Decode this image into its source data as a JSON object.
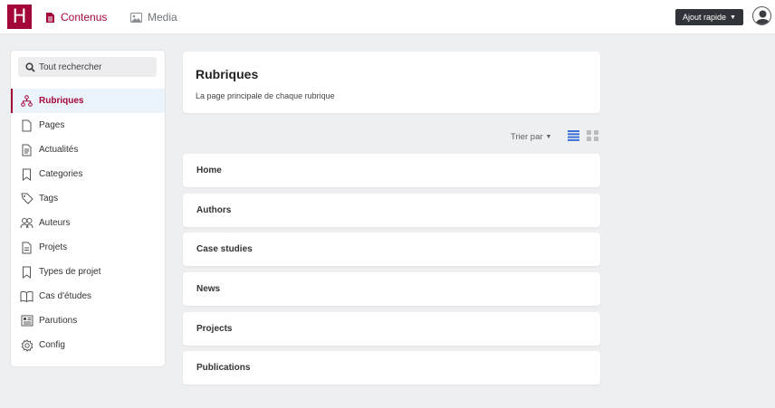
{
  "topbar": {
    "logo": "H",
    "nav": [
      {
        "label": "Contenus",
        "icon": "document-icon"
      },
      {
        "label": "Media",
        "icon": "image-icon"
      }
    ],
    "quick_add": "Ajout rapide"
  },
  "sidebar": {
    "search_placeholder": "Tout rechercher",
    "active_index": 0,
    "items": [
      {
        "label": "Rubriques",
        "icon": "sitemap-icon"
      },
      {
        "label": "Pages",
        "icon": "page-icon"
      },
      {
        "label": "Actualités",
        "icon": "news-icon"
      },
      {
        "label": "Categories",
        "icon": "bookmark-icon"
      },
      {
        "label": "Tags",
        "icon": "tag-icon"
      },
      {
        "label": "Auteurs",
        "icon": "users-icon"
      },
      {
        "label": "Projets",
        "icon": "project-icon"
      },
      {
        "label": "Types de projet",
        "icon": "bookmark-icon"
      },
      {
        "label": "Cas d'études",
        "icon": "book-icon"
      },
      {
        "label": "Parutions",
        "icon": "newspaper-icon"
      },
      {
        "label": "Config",
        "icon": "gear-icon"
      }
    ]
  },
  "main": {
    "title": "Rubriques",
    "subtitle": "La page principale de chaque rubrique",
    "sort_label": "Trier par",
    "rows": [
      {
        "label": "Home"
      },
      {
        "label": "Authors"
      },
      {
        "label": "Case studies"
      },
      {
        "label": "News"
      },
      {
        "label": "Projects"
      },
      {
        "label": "Publications"
      }
    ]
  },
  "colors": {
    "accent": "#a3073a",
    "active_bg": "#ebf3fb",
    "view_active": "#3a6fd8"
  }
}
